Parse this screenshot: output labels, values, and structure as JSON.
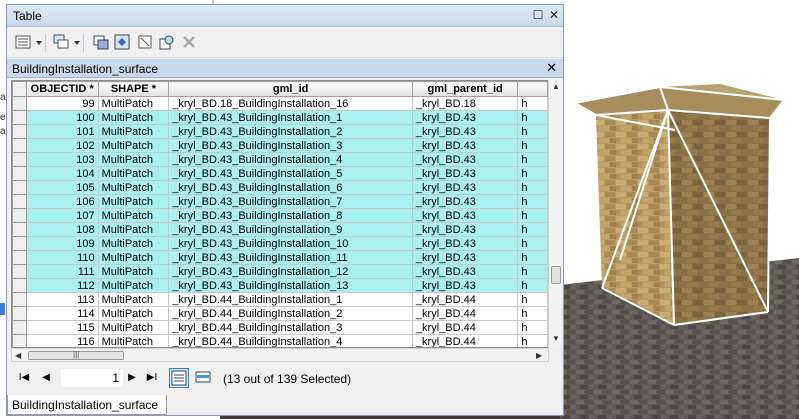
{
  "window": {
    "title": "Table",
    "pin_icon": "☐",
    "close_icon": "✕"
  },
  "table_tab": {
    "name": "BuildingInstallation_surface",
    "close_icon": "✕"
  },
  "columns": [
    "OBJECTID *",
    "SHAPE *",
    "gml_id",
    "gml_parent_id",
    ""
  ],
  "rows": [
    {
      "id": "99",
      "shape": "MultiPatch",
      "gml_id": "_kryl_BD.18_BuildingInstallation_16",
      "parent": "_kryl_BD.18",
      "extra": "h",
      "selected": false
    },
    {
      "id": "100",
      "shape": "MultiPatch",
      "gml_id": "_kryl_BD.43_BuildingInstallation_1",
      "parent": "_kryl_BD.43",
      "extra": "h",
      "selected": true
    },
    {
      "id": "101",
      "shape": "MultiPatch",
      "gml_id": "_kryl_BD.43_BuildingInstallation_2",
      "parent": "_kryl_BD.43",
      "extra": "h",
      "selected": true
    },
    {
      "id": "102",
      "shape": "MultiPatch",
      "gml_id": "_kryl_BD.43_BuildingInstallation_3",
      "parent": "_kryl_BD.43",
      "extra": "h",
      "selected": true
    },
    {
      "id": "103",
      "shape": "MultiPatch",
      "gml_id": "_kryl_BD.43_BuildingInstallation_4",
      "parent": "_kryl_BD.43",
      "extra": "h",
      "selected": true
    },
    {
      "id": "104",
      "shape": "MultiPatch",
      "gml_id": "_kryl_BD.43_BuildingInstallation_5",
      "parent": "_kryl_BD.43",
      "extra": "h",
      "selected": true
    },
    {
      "id": "105",
      "shape": "MultiPatch",
      "gml_id": "_kryl_BD.43_BuildingInstallation_6",
      "parent": "_kryl_BD.43",
      "extra": "h",
      "selected": true
    },
    {
      "id": "106",
      "shape": "MultiPatch",
      "gml_id": "_kryl_BD.43_BuildingInstallation_7",
      "parent": "_kryl_BD.43",
      "extra": "h",
      "selected": true
    },
    {
      "id": "107",
      "shape": "MultiPatch",
      "gml_id": "_kryl_BD.43_BuildingInstallation_8",
      "parent": "_kryl_BD.43",
      "extra": "h",
      "selected": true
    },
    {
      "id": "108",
      "shape": "MultiPatch",
      "gml_id": "_kryl_BD.43_BuildingInstallation_9",
      "parent": "_kryl_BD.43",
      "extra": "h",
      "selected": true
    },
    {
      "id": "109",
      "shape": "MultiPatch",
      "gml_id": "_kryl_BD.43_BuildingInstallation_10",
      "parent": "_kryl_BD.43",
      "extra": "h",
      "selected": true
    },
    {
      "id": "110",
      "shape": "MultiPatch",
      "gml_id": "_kryl_BD.43_BuildingInstallation_11",
      "parent": "_kryl_BD.43",
      "extra": "h",
      "selected": true
    },
    {
      "id": "111",
      "shape": "MultiPatch",
      "gml_id": "_kryl_BD.43_BuildingInstallation_12",
      "parent": "_kryl_BD.43",
      "extra": "h",
      "selected": true
    },
    {
      "id": "112",
      "shape": "MultiPatch",
      "gml_id": "_kryl_BD.43_BuildingInstallation_13",
      "parent": "_kryl_BD.43",
      "extra": "h",
      "selected": true
    },
    {
      "id": "113",
      "shape": "MultiPatch",
      "gml_id": "_kryl_BD.44_BuildingInstallation_1",
      "parent": "_kryl_BD.44",
      "extra": "h",
      "selected": false
    },
    {
      "id": "114",
      "shape": "MultiPatch",
      "gml_id": "_kryl_BD.44_BuildingInstallation_2",
      "parent": "_kryl_BD.44",
      "extra": "h",
      "selected": false
    },
    {
      "id": "115",
      "shape": "MultiPatch",
      "gml_id": "_kryl_BD.44_BuildingInstallation_3",
      "parent": "_kryl_BD.44",
      "extra": "h",
      "selected": false
    },
    {
      "id": "116",
      "shape": "MultiPatch",
      "gml_id": "_kryl_BD.44_BuildingInstallation_4",
      "parent": "_kryl_BD.44",
      "extra": "h",
      "selected": false
    }
  ],
  "hscroll_grip": "|||",
  "nav": {
    "first": "I◀",
    "prev": "◀",
    "record": "1",
    "next": "▶",
    "last": "▶I",
    "status": "(13 out of 139 Selected)"
  },
  "bottom_tab": "BuildingInstallation_surface",
  "left_strip": [
    "a",
    "e",
    "a"
  ],
  "colors": {
    "selected_row": "#aaf0f0",
    "title_bar": "#dfe9f5",
    "tab_bar": "#c8d8ec"
  }
}
